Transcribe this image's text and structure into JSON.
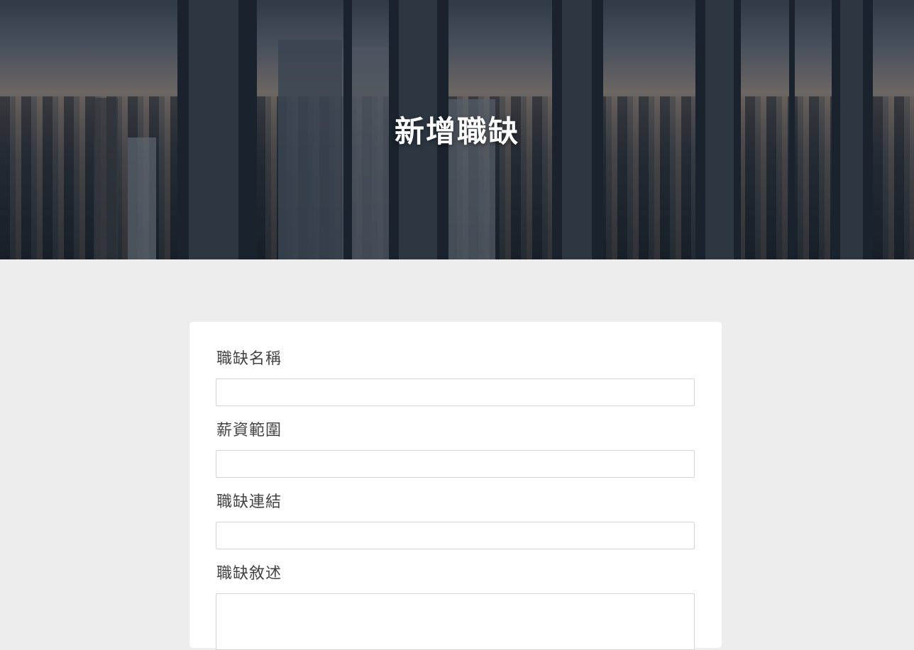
{
  "hero": {
    "title": "新增職缺"
  },
  "form": {
    "fields": [
      {
        "label": "職缺名稱",
        "value": "",
        "placeholder": ""
      },
      {
        "label": "薪資範圍",
        "value": "",
        "placeholder": ""
      },
      {
        "label": "職缺連結",
        "value": "",
        "placeholder": ""
      },
      {
        "label": "職缺敘述",
        "value": "",
        "placeholder": ""
      }
    ]
  }
}
